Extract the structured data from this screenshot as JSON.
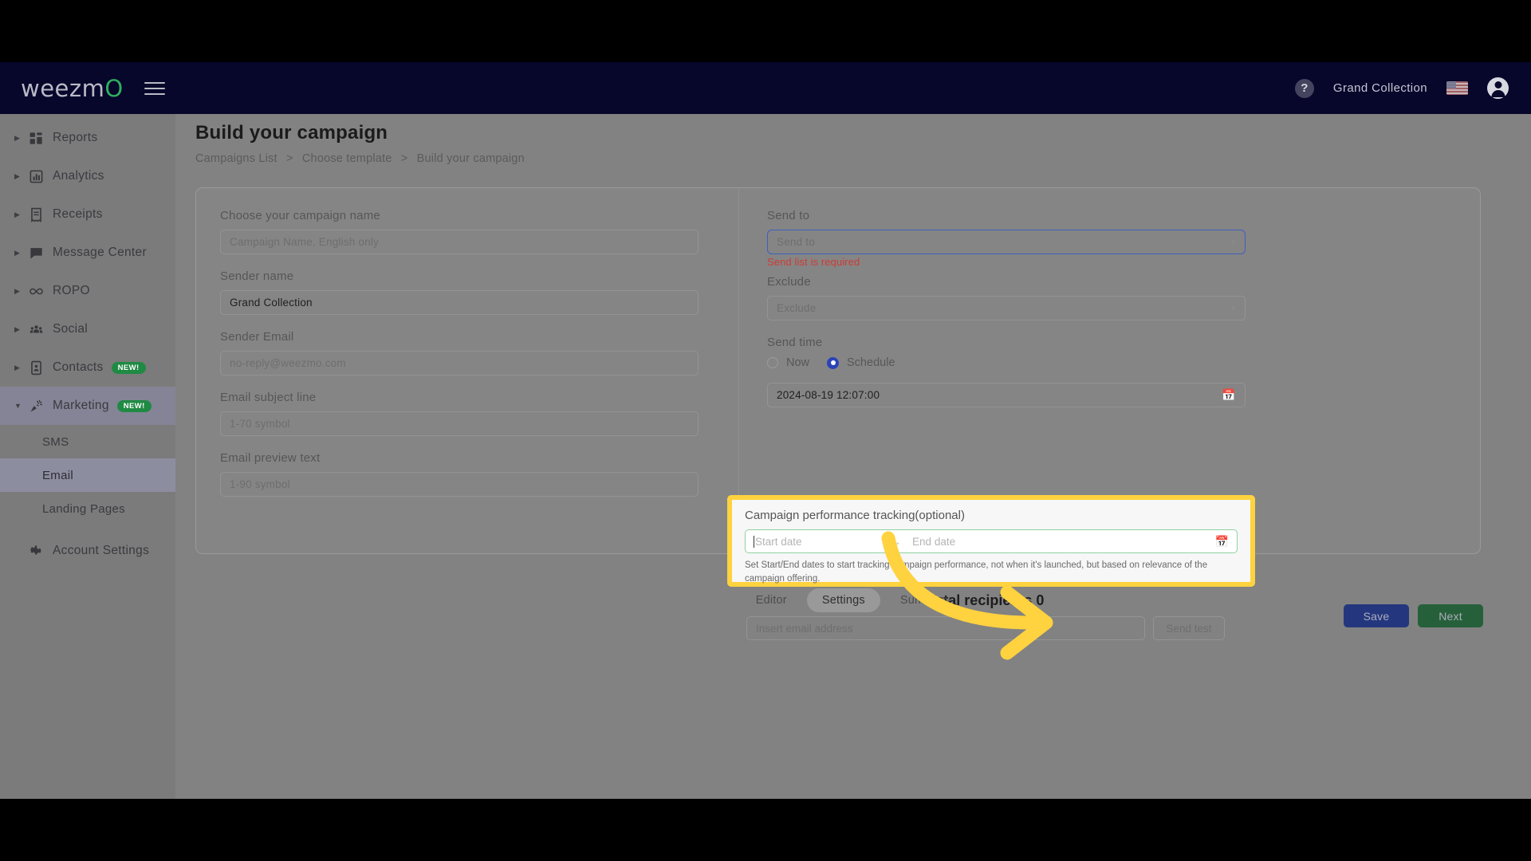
{
  "brand": {
    "logo_text": "weezm",
    "logo_accent_char": "O",
    "accent_green": "#2fae5f",
    "header_bg": "#07062b"
  },
  "topbar": {
    "help_icon": "question-mark-circle-icon",
    "account_name": "Grand Collection",
    "flag_icon": "us-flag-icon",
    "avatar_icon": "account-circle-icon",
    "menu_icon": "hamburger-menu-icon"
  },
  "sidebar": {
    "items": [
      {
        "label": "Reports",
        "icon": "dashboard-grid-icon",
        "expandable": true,
        "expanded": false,
        "badge": ""
      },
      {
        "label": "Analytics",
        "icon": "bar-chart-icon",
        "expandable": true,
        "expanded": false,
        "badge": ""
      },
      {
        "label": "Receipts",
        "icon": "receipt-icon",
        "expandable": true,
        "expanded": false,
        "badge": ""
      },
      {
        "label": "Message Center",
        "icon": "chat-bubble-icon",
        "expandable": true,
        "expanded": false,
        "badge": ""
      },
      {
        "label": "ROPO",
        "icon": "infinity-icon",
        "expandable": true,
        "expanded": false,
        "badge": ""
      },
      {
        "label": "Social",
        "icon": "people-group-icon",
        "expandable": true,
        "expanded": false,
        "badge": ""
      },
      {
        "label": "Contacts",
        "icon": "contact-card-icon",
        "expandable": true,
        "expanded": false,
        "badge": "NEW!"
      },
      {
        "label": "Marketing",
        "icon": "megaphone-icon",
        "expandable": true,
        "expanded": true,
        "badge": "NEW!"
      }
    ],
    "sub_items": [
      {
        "label": "SMS",
        "selected": false
      },
      {
        "label": "Email",
        "selected": true
      },
      {
        "label": "Landing Pages",
        "selected": false
      }
    ],
    "footer_item": {
      "label": "Account Settings",
      "icon": "gear-icon"
    },
    "badge_color": "#1f8a43"
  },
  "page": {
    "title": "Build your campaign",
    "breadcrumb": [
      "Campaigns List",
      "Choose template",
      "Build your campaign"
    ],
    "breadcrumb_separator": ">"
  },
  "form_left": {
    "campaign_name_label": "Choose your campaign name",
    "campaign_name_placeholder": "Campaign Name, English only",
    "campaign_name_value": "",
    "sender_name_label": "Sender name",
    "sender_name_value": "Grand Collection",
    "sender_email_label": "Sender Email",
    "sender_email_placeholder": "no-reply@weezmo.com",
    "sender_email_value": "",
    "subject_label": "Email subject line",
    "subject_placeholder": "1-70 symbol",
    "subject_value": "",
    "preview_label": "Email preview text",
    "preview_placeholder": "1-90 symbol",
    "preview_value": ""
  },
  "form_right": {
    "send_to_label": "Send to",
    "send_to_placeholder": "Send to",
    "send_to_value": "",
    "send_to_error": "Send list is required",
    "send_to_error_color": "#cf3b34",
    "send_to_focus_color": "#3f5fc0",
    "exclude_label": "Exclude",
    "exclude_placeholder": "Exclude",
    "exclude_value": "",
    "send_time_label": "Send time",
    "radio_now_label": "Now",
    "radio_schedule_label": "Schedule",
    "radio_selected": "Schedule",
    "radio_selected_color": "#2b43b8",
    "schedule_datetime": "2024-08-19 12:07:00",
    "calendar_icon": "calendar-icon"
  },
  "tracking": {
    "label": "Campaign performance tracking(optional)",
    "start_placeholder": "Start date",
    "start_value": "",
    "end_placeholder": "End date",
    "end_value": "",
    "range_separator": "→",
    "help_text": "Set Start/End dates to start tracking campaign performance, not when it's launched, but based on relevance of the campaign offering.",
    "highlight_color": "#ffd23f",
    "input_border_color": "#8fd19e",
    "calendar_icon": "calendar-icon"
  },
  "recipients": {
    "total_label": "Total recipients 0",
    "test_email_placeholder": "Insert email address",
    "test_email_value": "",
    "send_test_label": "Send test"
  },
  "tabs": [
    {
      "label": "Editor",
      "active": false
    },
    {
      "label": "Settings",
      "active": true
    },
    {
      "label": "Summary",
      "active": false
    }
  ],
  "footer": {
    "save_label": "Save",
    "save_color": "#24377e",
    "next_label": "Next",
    "next_color": "#26603a"
  },
  "annotation": {
    "arrow_color": "#ffd23f",
    "arrow_shape": "curved-right-arrow"
  }
}
